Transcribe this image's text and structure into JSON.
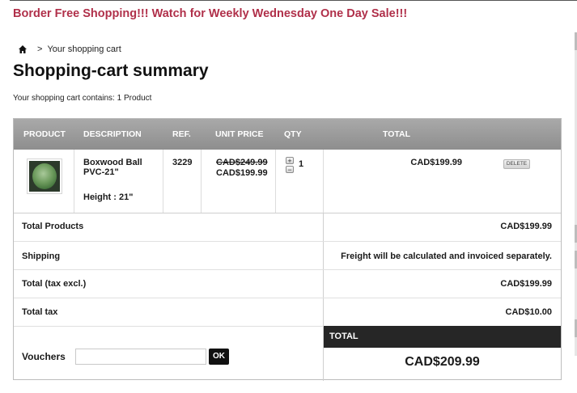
{
  "promo": {
    "text": "Border Free Shopping!!! Watch for Weekly Wednesday One Day Sale!!!"
  },
  "breadcrumb": {
    "home_icon": "home-icon",
    "separator": ">",
    "current": "Your shopping cart"
  },
  "page": {
    "title": "Shopping-cart summary",
    "cart_count": "Your shopping cart contains: 1 Product"
  },
  "table": {
    "headers": {
      "product": "PRODUCT",
      "description": "DESCRIPTION",
      "ref": "REF.",
      "unit_price": "UNIT PRICE",
      "qty": "QTY",
      "total": "TOTAL"
    },
    "item": {
      "name": "Boxwood Ball PVC-21\"",
      "height": "Height : 21\"",
      "ref": "3229",
      "old_price": "CAD$249.99",
      "price": "CAD$199.99",
      "qty": "1",
      "qty_up": "+",
      "qty_down": "−",
      "total": "CAD$199.99",
      "delete_label": "DELETE"
    }
  },
  "summary": {
    "total_products": {
      "label": "Total Products",
      "value": "CAD$199.99"
    },
    "shipping": {
      "label": "Shipping",
      "value": "Freight will be calculated and invoiced separately."
    },
    "total_tax_excl": {
      "label": "Total (tax excl.)",
      "value": "CAD$199.99"
    },
    "total_tax": {
      "label": "Total tax",
      "value": "CAD$10.00"
    },
    "total_label": "TOTAL",
    "grand_total": "CAD$209.99"
  },
  "vouchers": {
    "label": "Vouchers",
    "value": "",
    "ok_label": "OK"
  },
  "colors": {
    "promo": "#b0304a",
    "header_bg": "#9a9a9a",
    "total_bg": "#262626"
  }
}
